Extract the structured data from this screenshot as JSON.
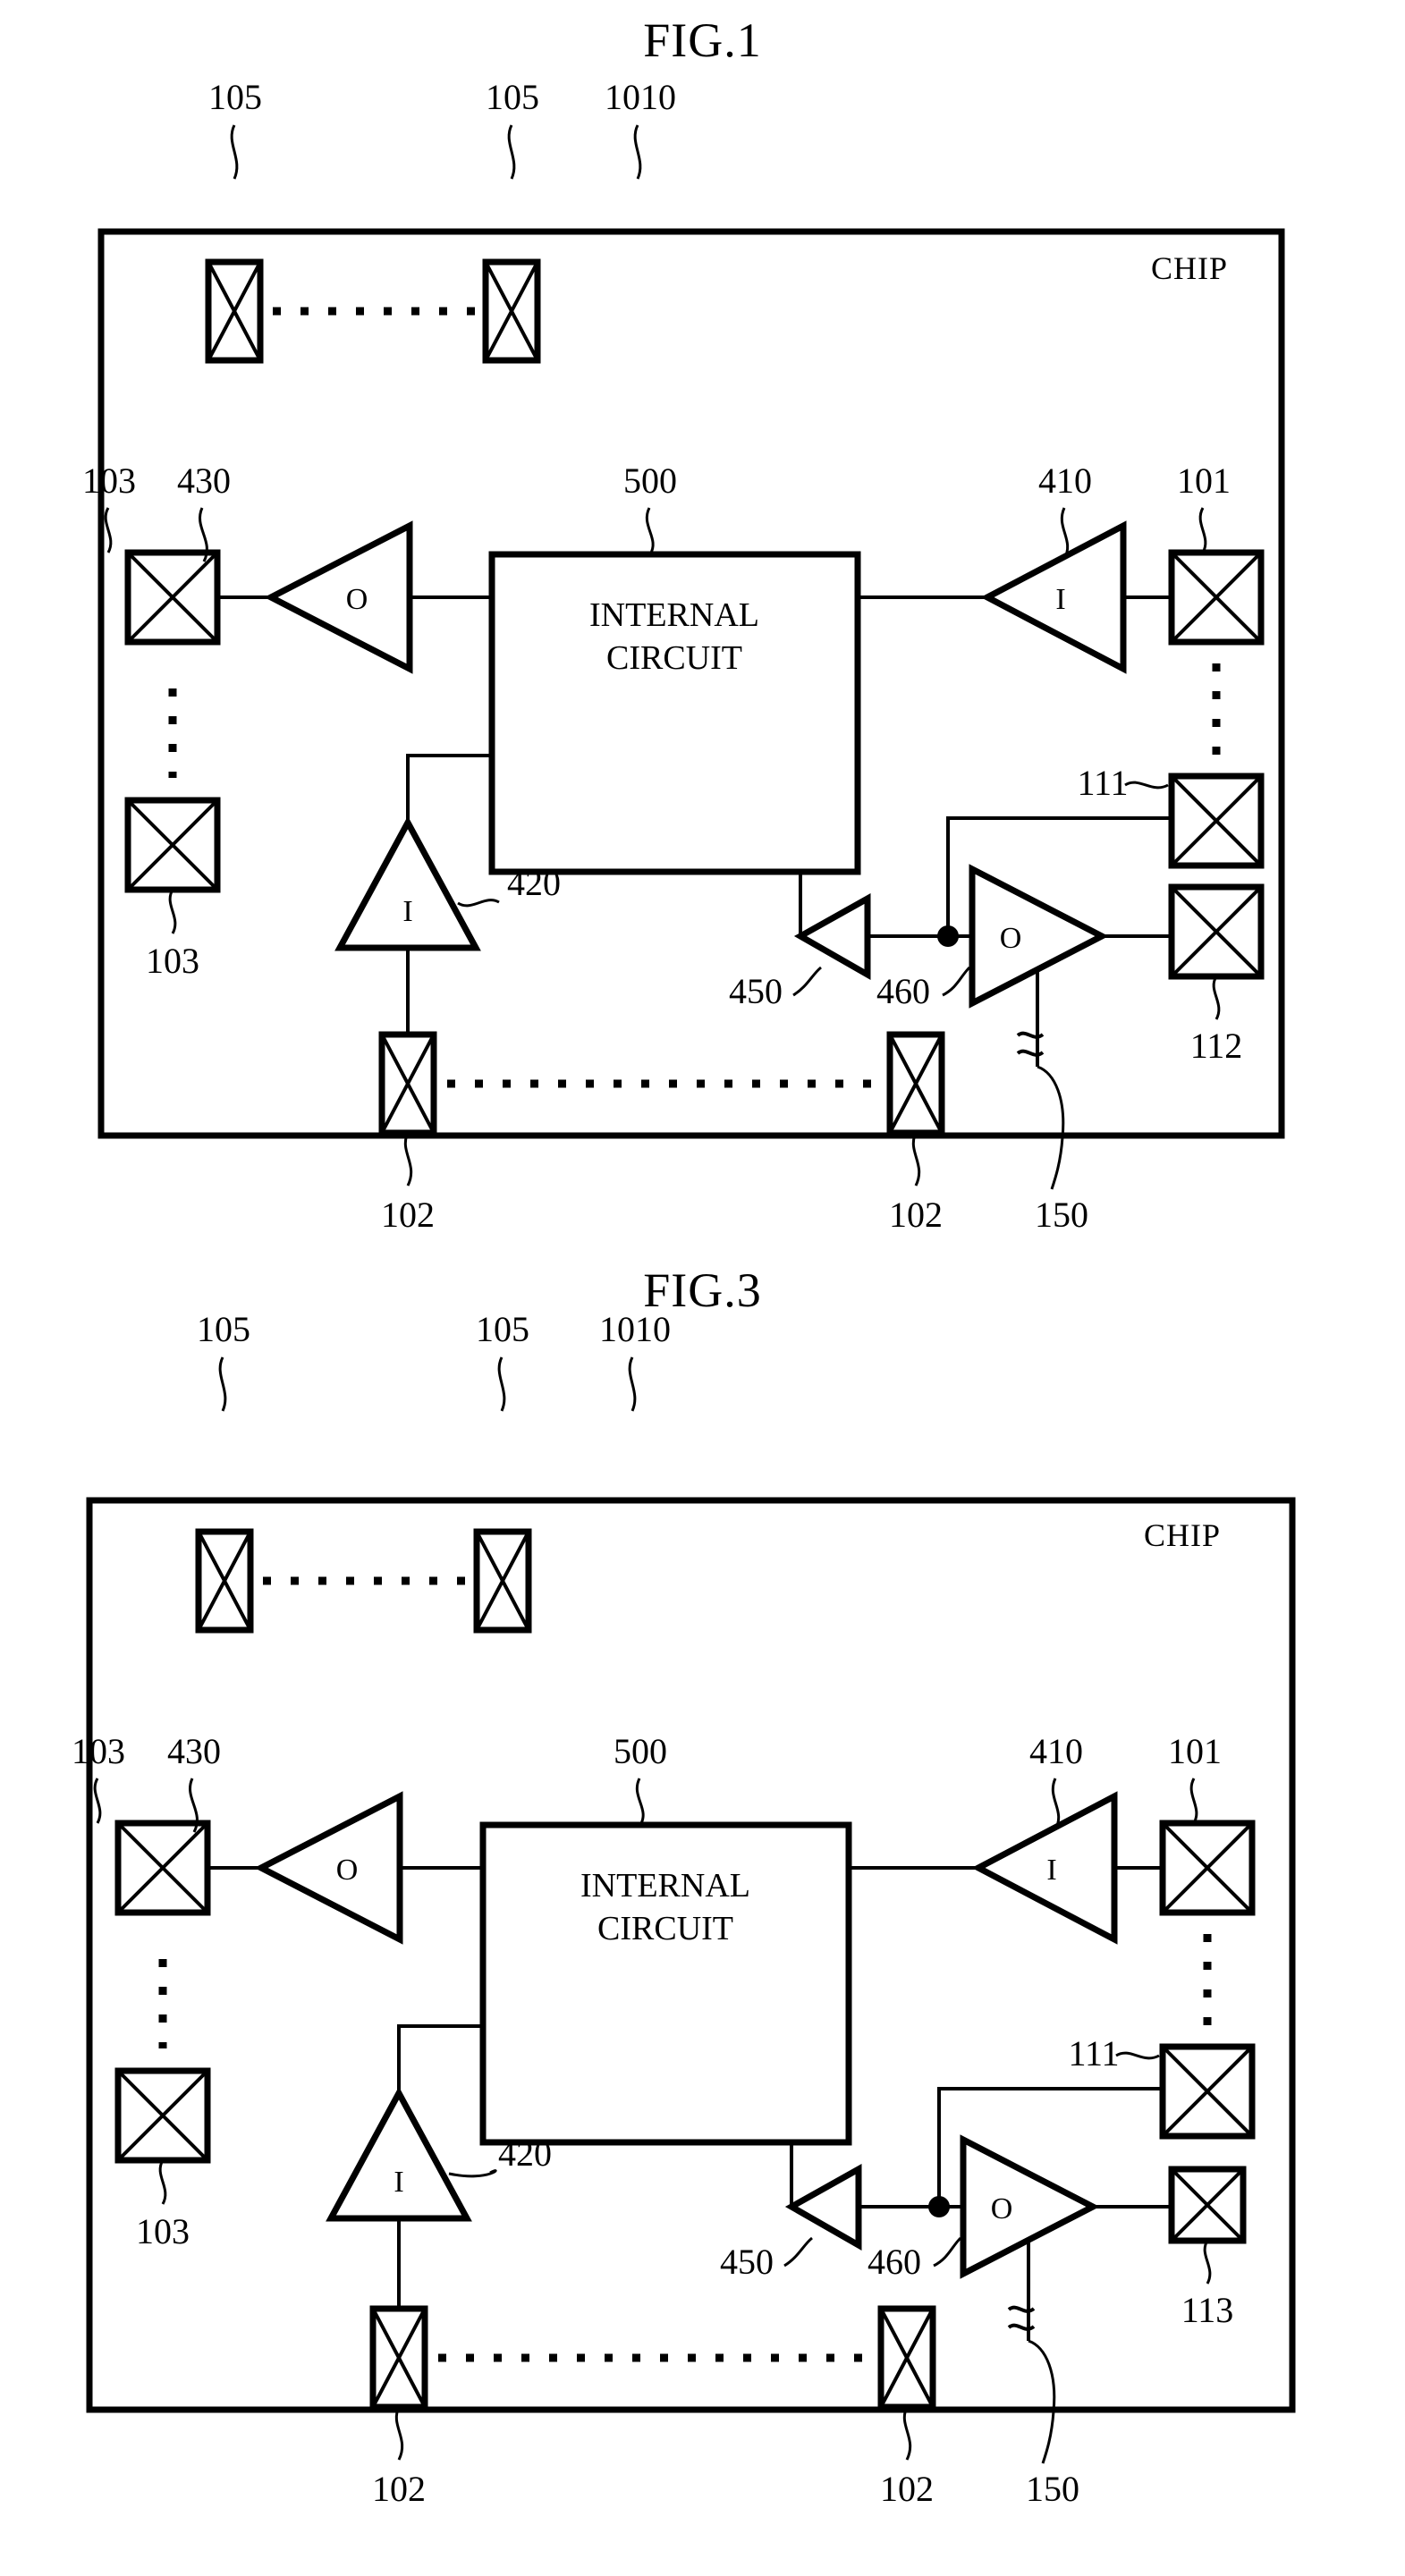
{
  "figures": [
    {
      "id": "fig1",
      "title": "FIG.1",
      "chip_label": "CHIP",
      "chip_ref": "1010",
      "internal_block": {
        "line1": "INTERNAL",
        "line2": "CIRCUIT",
        "ref": "500"
      },
      "top_pads": {
        "left_ref": "105",
        "right_ref": "105"
      },
      "bottom_pads": {
        "left_ref": "102",
        "right_ref": "102"
      },
      "left_pads": {
        "top_ref": "103",
        "bottom_ref": "103"
      },
      "right_pads": {
        "top_ref": "101",
        "mid_ref": "111",
        "bottom_ref": "112"
      },
      "amplifiers": [
        {
          "ref": "430",
          "symbol": "O",
          "direction": "left"
        },
        {
          "ref": "410",
          "symbol": "I",
          "direction": "right"
        },
        {
          "ref": "420",
          "symbol": "I",
          "direction": "up"
        },
        {
          "ref": "450",
          "symbol": "",
          "direction": "right"
        },
        {
          "ref": "460",
          "symbol": "O",
          "direction": "right"
        }
      ],
      "supply_line_ref": "150"
    },
    {
      "id": "fig3",
      "title": "FIG.3",
      "chip_label": "CHIP",
      "chip_ref": "1010",
      "internal_block": {
        "line1": "INTERNAL",
        "line2": "CIRCUIT",
        "ref": "500"
      },
      "top_pads": {
        "left_ref": "105",
        "right_ref": "105"
      },
      "bottom_pads": {
        "left_ref": "102",
        "right_ref": "102"
      },
      "left_pads": {
        "top_ref": "103",
        "bottom_ref": "103"
      },
      "right_pads": {
        "top_ref": "101",
        "mid_ref": "111",
        "bottom_ref": "113"
      },
      "amplifiers": [
        {
          "ref": "430",
          "symbol": "O",
          "direction": "left"
        },
        {
          "ref": "410",
          "symbol": "I",
          "direction": "right"
        },
        {
          "ref": "420",
          "symbol": "I",
          "direction": "up"
        },
        {
          "ref": "450",
          "symbol": "",
          "direction": "right"
        },
        {
          "ref": "460",
          "symbol": "O",
          "direction": "right"
        }
      ],
      "supply_line_ref": "150"
    }
  ],
  "colors": {
    "ink": "#000000",
    "paper": "#ffffff"
  }
}
